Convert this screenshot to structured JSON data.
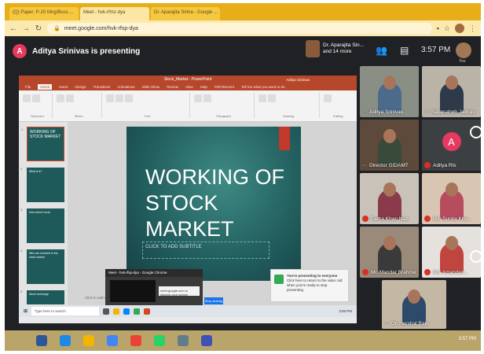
{
  "browser": {
    "tabs": [
      "(Q) Paper: P-20 Mng/Buss ...",
      "Meet - hvk-rfmz-dya",
      "Dr. Aparajita Sinha - Google ..."
    ],
    "url": "meet.google.com/hvk-rfsp-dya"
  },
  "meet": {
    "presenter_initial": "A",
    "presenting_text": "Aditya Srinivas is presenting",
    "others_name": "Dr. Aparajita Sin...",
    "others_more": "and 14 more",
    "clock": "3:57 PM",
    "you_label": "You"
  },
  "powerpoint": {
    "title": "Stock_Market - PowerPoint",
    "user": "Aditya Srinivas",
    "tabs": [
      "File",
      "Home",
      "Insert",
      "Design",
      "Transitions",
      "Animations",
      "Slide Show",
      "Review",
      "View",
      "Help",
      "PDFelement",
      "Tell me what you want to do"
    ],
    "ribbon_groups": [
      "Clipboard",
      "Slides",
      "Font",
      "Paragraph",
      "Drawing",
      "Editing"
    ],
    "slide_title_lines": [
      "WORKING OF",
      "STOCK",
      "MARKET"
    ],
    "subtitle_placeholder": "CLICK TO ADD SUBTITLE",
    "thumbnails": [
      {
        "num": "1",
        "text": "WORKING OF STOCK MARKET"
      },
      {
        "num": "2",
        "text": "What is it?"
      },
      {
        "num": "3",
        "text": "How does it work"
      },
      {
        "num": "4",
        "text": "Who are involved in the stock market"
      },
      {
        "num": "5",
        "text": "Stock exchange"
      }
    ],
    "notes_placeholder": "Click to add notes",
    "windows_search": "Type here to search",
    "windows_time": "3:56 PM",
    "share_pop_title": "Meet - hvk-rfsp-dya - Google Chrome",
    "share_pop_status": "meet.google.com is sharing your screen",
    "stop_sharing": "Stop sharing",
    "toast_title": "You're presenting to everyone",
    "toast_body": "Click here to return to the video call when you're ready to stop presenting"
  },
  "participants": [
    {
      "name": "Aditya Srinivas",
      "muted": false,
      "bg": "#8a8f86",
      "shirt": "#4a6b8a"
    },
    {
      "name": "Babasaheb Jadhav",
      "muted": false,
      "bg": "#b9b3a8",
      "shirt": "#2e3a4a"
    },
    {
      "name": "Director GIDAMT",
      "muted": false,
      "bg": "#5d4a3a",
      "shirt": "#39493a"
    },
    {
      "name": "Aditya Rts",
      "muted": true,
      "avatar": "A"
    },
    {
      "name": "Farha Khan Naz",
      "muted": true,
      "bg": "#c9c2b8",
      "shirt": "#8a3a4a"
    },
    {
      "name": "Ms. Sunita Kha...",
      "muted": true,
      "bg": "#d9c6b2",
      "shirt": "#b84c5f"
    },
    {
      "name": "Mr. Mandar Brahme",
      "muted": true,
      "bg": "#9a8a7a",
      "shirt": "#3a3a3a"
    },
    {
      "name": "Ms. Amanden...",
      "muted": true,
      "bg": "#e5e1dc",
      "shirt": "#c0453e"
    },
    {
      "name": "Dr. Harshal Raje",
      "muted": false,
      "bg": "#c4b8a4",
      "shirt": "#2d4a6a"
    }
  ],
  "colors": {
    "meet_bg": "#202124",
    "ppt_accent": "#b7472a",
    "slide_teal": "#22605f",
    "muted_red": "#d93025",
    "avatar_pink": "#e53960"
  },
  "taskbar": {
    "time": "3:57 PM"
  }
}
